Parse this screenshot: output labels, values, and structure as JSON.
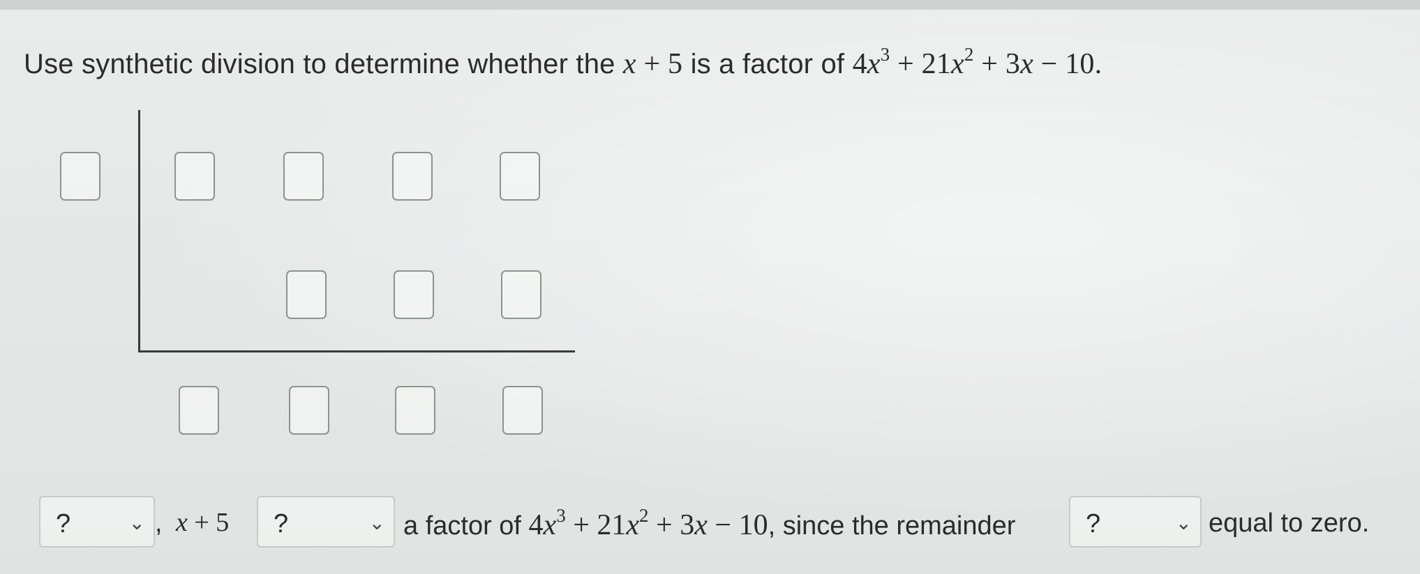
{
  "question": {
    "prefix": "Use synthetic division to determine whether the ",
    "divisor_var": "x",
    "divisor_rest": " + 5",
    "middle": " is a factor of ",
    "poly_a": "4",
    "poly_x1": "x",
    "poly_e1": "3",
    "poly_b": " + 21",
    "poly_x2": "x",
    "poly_e2": "2",
    "poly_c": " + 3",
    "poly_x3": "x",
    "poly_d": " − 10."
  },
  "answer": {
    "select1": {
      "value": "?",
      "chevron": "⌄"
    },
    "comma": ",",
    "divisor_var": "x",
    "divisor_rest": " + 5",
    "select2": {
      "value": "?",
      "chevron": "⌄"
    },
    "text_a": "a factor of ",
    "poly_a": "4",
    "poly_x1": "x",
    "poly_e1": "3",
    "poly_b": " + 21",
    "poly_x2": "x",
    "poly_e2": "2",
    "poly_c": " + 3",
    "poly_x3": "x",
    "poly_d": " − 10",
    "text_b": ", since the remainder",
    "select3": {
      "value": "?",
      "chevron": "⌄"
    },
    "text_c": "equal to zero."
  },
  "icons": {
    "chevron": "chevron-down-icon"
  }
}
